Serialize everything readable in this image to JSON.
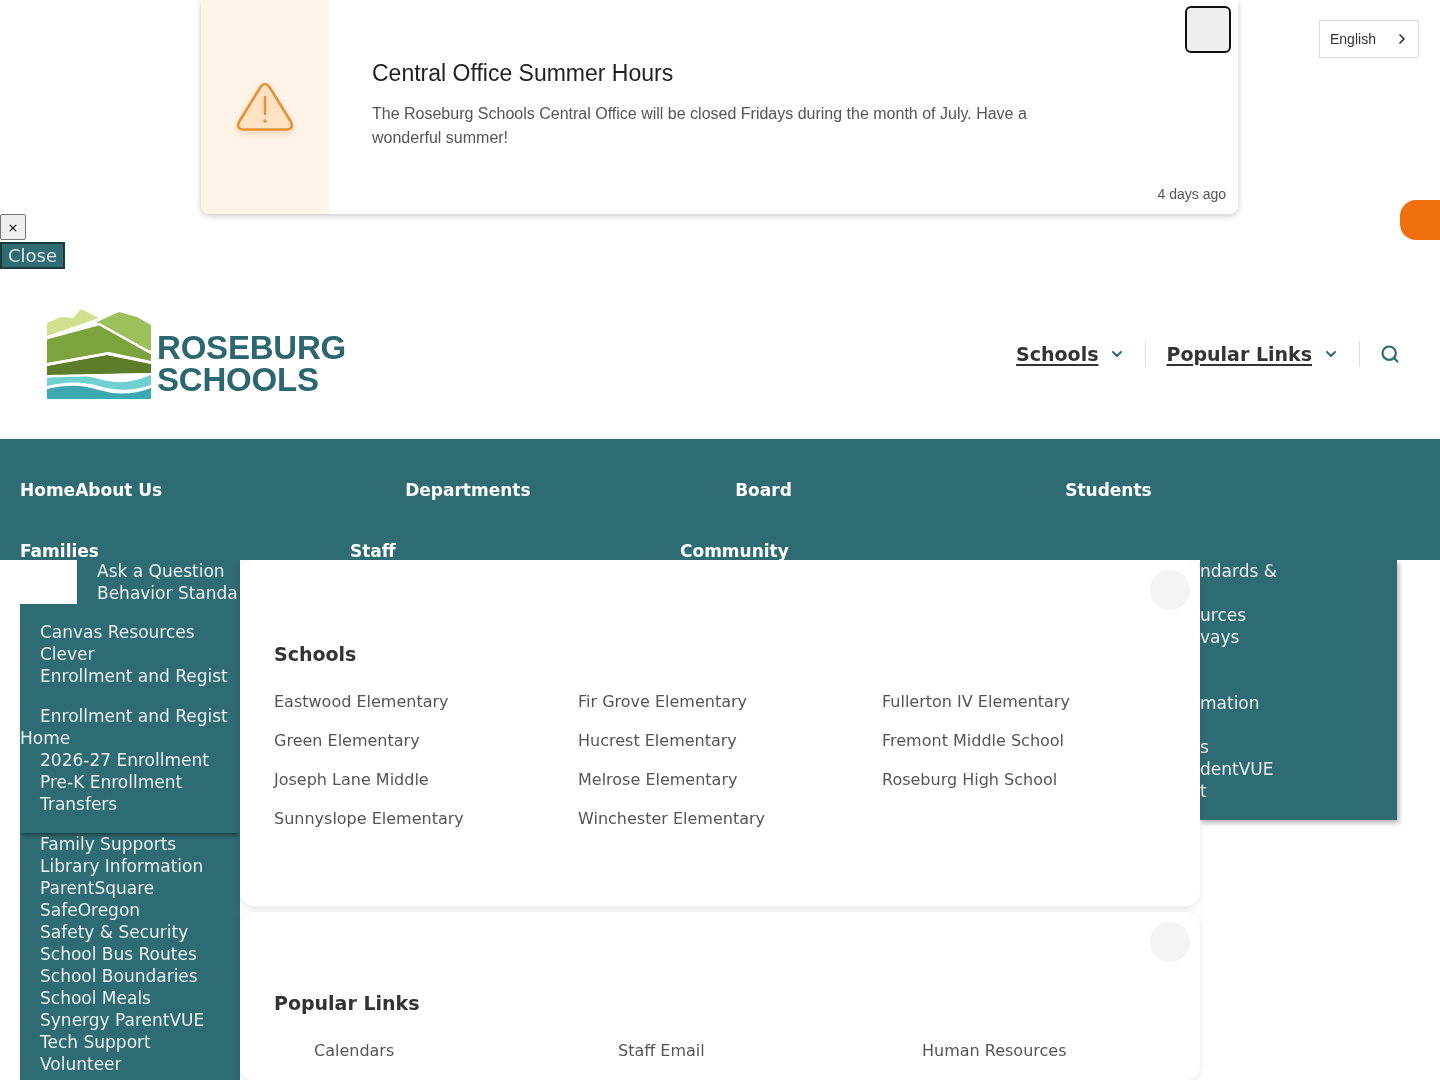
{
  "alert": {
    "title": "Central Office Summer Hours",
    "message": "The Roseburg Schools Central Office will be closed Fridays during the month of July. Have a wonderful summer!",
    "time": "4 days ago"
  },
  "language_select": {
    "value": "English"
  },
  "close_controls": [
    {
      "label": "×",
      "kind": "small"
    },
    {
      "label": "Close",
      "kind": "teal"
    }
  ],
  "logo": {
    "lines": [
      "ROSEBURG",
      "SCHOOLS"
    ]
  },
  "header_links": [
    {
      "label": "Schools"
    },
    {
      "label": "Popular Links"
    }
  ],
  "main_nav": {
    "items": [
      {
        "label": "Home",
        "kind": "link"
      },
      {
        "label": "About Us",
        "kind": "menu"
      },
      {
        "label": "Departments",
        "kind": "menu"
      },
      {
        "label": "Board",
        "kind": "menu"
      },
      {
        "label": "Students",
        "kind": "menu"
      },
      {
        "label": "Families",
        "kind": "menu"
      },
      {
        "label": "Staff",
        "kind": "menu"
      },
      {
        "label": "Community",
        "kind": "menu"
      }
    ]
  },
  "upper_dropdown": {
    "items": [
      "Ask a Question",
      "Behavior Standa"
    ]
  },
  "left_dropdown": {
    "items": [
      {
        "label": "Canvas Resources"
      },
      {
        "label": "Clever"
      },
      {
        "label": "Enrollment and Regist",
        "expanded": true,
        "submenu": {
          "heading": [
            "Enrollment and Regist",
            "Home"
          ],
          "children": [
            {
              "label": "2026-27 Enrollment"
            },
            {
              "label": "Pre-K Enrollment"
            },
            {
              "label": "Transfers"
            }
          ]
        }
      },
      {
        "label": "Family Supports"
      },
      {
        "label": "Library Information"
      },
      {
        "label": "ParentSquare"
      },
      {
        "label": "SafeOregon"
      },
      {
        "label": "Safety & Security"
      },
      {
        "label": "School Bus Routes"
      },
      {
        "label": "School Boundaries"
      },
      {
        "label": "School Meals"
      },
      {
        "label": "Synergy ParentVUE"
      },
      {
        "label": "Tech Support"
      },
      {
        "label": "Volunteer"
      }
    ]
  },
  "schools_panel": {
    "title": "Schools",
    "links": [
      "Eastwood Elementary",
      "Fir Grove Elementary",
      "Fullerton IV Elementary",
      "Green Elementary",
      "Hucrest Elementary",
      "Fremont Middle School",
      "Joseph Lane Middle",
      "Melrose Elementary",
      "Roseburg High School",
      "Sunnyslope Elementary",
      "Winchester Elementary"
    ]
  },
  "popular_links_panel": {
    "title": "Popular Links",
    "links": [
      "Calendars",
      "Staff Email",
      "Human Resources"
    ]
  },
  "right_dropdown": {
    "fragments": [
      "ndards &",
      "urces",
      "vays",
      "mation",
      "s",
      "dentVUE",
      "t"
    ]
  }
}
